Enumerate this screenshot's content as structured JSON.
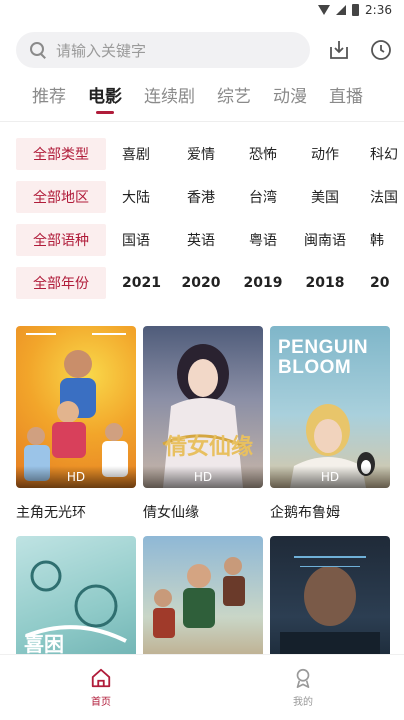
{
  "status_bar": {
    "time": "2:36"
  },
  "search": {
    "placeholder": "请输入关键字"
  },
  "tabs": [
    {
      "label": "推荐"
    },
    {
      "label": "电影"
    },
    {
      "label": "连续剧"
    },
    {
      "label": "综艺"
    },
    {
      "label": "动漫"
    },
    {
      "label": "直播"
    }
  ],
  "active_tab": "电影",
  "filters": {
    "genre": {
      "label": "全部类型",
      "options": [
        "喜剧",
        "爱情",
        "恐怖",
        "动作",
        "科幻"
      ]
    },
    "region": {
      "label": "全部地区",
      "options": [
        "大陆",
        "香港",
        "台湾",
        "美国",
        "法国"
      ]
    },
    "language": {
      "label": "全部语种",
      "options": [
        "国语",
        "英语",
        "粤语",
        "闽南语",
        "韩"
      ]
    },
    "year": {
      "label": "全部年份",
      "options": [
        "2021",
        "2020",
        "2019",
        "2018",
        "20"
      ]
    }
  },
  "movies": [
    {
      "title": "主角无光环",
      "badge": "HD"
    },
    {
      "title": "倩女仙缘",
      "badge": "HD"
    },
    {
      "title": "企鹅布鲁姆",
      "badge": "HD",
      "poster_text": "PENGUIN BLOOM"
    },
    {
      "title": "",
      "badge": ""
    },
    {
      "title": "",
      "badge": ""
    },
    {
      "title": "",
      "badge": ""
    }
  ],
  "bottom_nav": [
    {
      "label": "首页",
      "icon": "home-icon",
      "active": true
    },
    {
      "label": "我的",
      "icon": "profile-icon",
      "active": false
    }
  ],
  "colors": {
    "accent": "#b01c3a",
    "chip_bg": "#fbeeee"
  }
}
